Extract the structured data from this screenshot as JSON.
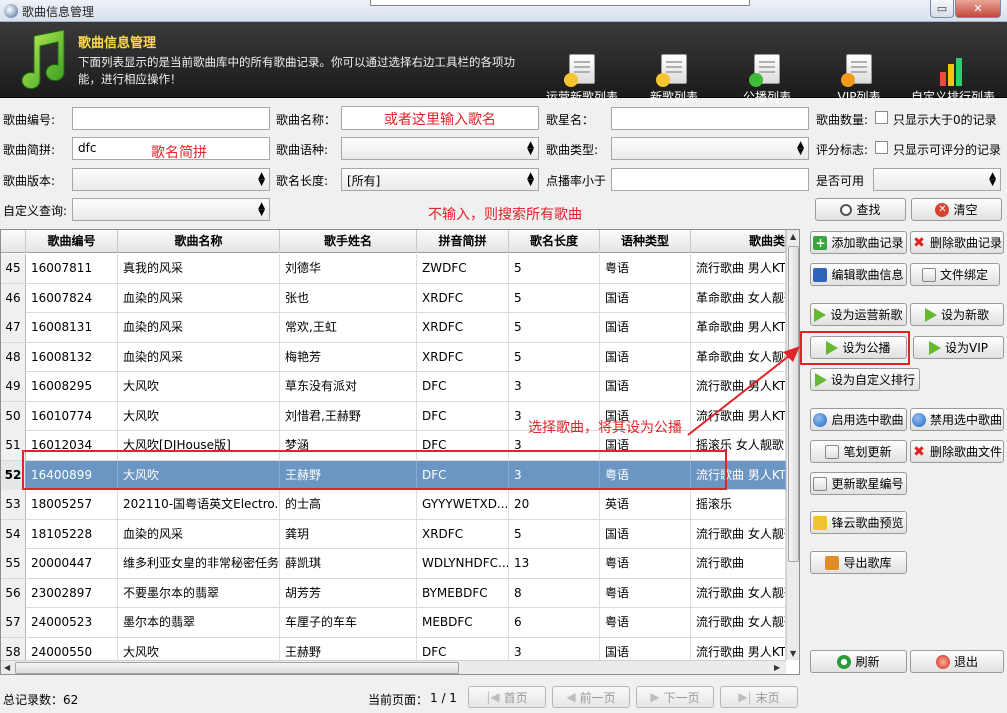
{
  "window": {
    "title": "歌曲信息管理",
    "close_label": "✕",
    "min_label": "▭"
  },
  "banner": {
    "title": "歌曲信息管理",
    "description": "下面列表显示的是当前歌曲库中的所有歌曲记录。你可以通过选择右边工具栏的各项功能，进行相应操作！",
    "tools": [
      "运营新歌列表",
      "新歌列表",
      "公播列表",
      "VIP列表",
      "自定义排行列表"
    ]
  },
  "form": {
    "song_no_label": "歌曲编号:",
    "song_name_label": "歌曲名称：",
    "song_name_placeholder": "或者这里输入歌名",
    "singer_label": "歌星名：",
    "song_count_label": "歌曲数量:",
    "only_gt0_label": "只显示大于0的记录",
    "pinyin_label": "歌曲简拼:",
    "pinyin_value": "dfc",
    "pinyin_annotation": "歌名简拼",
    "lang_label": "歌曲语种:",
    "type_label": "歌曲类型:",
    "rating_flag_label": "评分标志:",
    "only_rated_label": "只显示可评分的记录",
    "version_label": "歌曲版本:",
    "name_len_label": "歌名长度:",
    "name_len_value": "[所有]",
    "play_rate_label": "点播率小于",
    "usable_label": "是否可用",
    "custom_query_label": "自定义查询:",
    "hint_annotation": "不输入，则搜索所有歌曲",
    "search_btn": "查找",
    "clear_btn": "清空"
  },
  "table": {
    "headers": [
      "歌曲编号",
      "歌曲名称",
      "歌手姓名",
      "拼音简拼",
      "歌名长度",
      "语种类型",
      "歌曲类"
    ],
    "rows": [
      [
        "45",
        "16007811",
        "真我的风采",
        "刘德华",
        "ZWDFC",
        "5",
        "粤语",
        "流行歌曲 男人KTV"
      ],
      [
        "46",
        "16007824",
        "血染的风采",
        "张也",
        "XRDFC",
        "5",
        "国语",
        "革命歌曲 女人靓歌"
      ],
      [
        "47",
        "16008131",
        "血染的风采",
        "常欢,王虹",
        "XRDFC",
        "5",
        "国语",
        "革命歌曲 男人KTV"
      ],
      [
        "48",
        "16008132",
        "血染的风采",
        "梅艳芳",
        "XRDFC",
        "5",
        "国语",
        "革命歌曲 女人靓歌"
      ],
      [
        "49",
        "16008295",
        "大风吹",
        "草东没有派对",
        "DFC",
        "3",
        "国语",
        "流行歌曲 男人KTV"
      ],
      [
        "50",
        "16010774",
        "大风吹",
        "刘惜君,王赫野",
        "DFC",
        "3",
        "国语",
        "流行歌曲 男人KTV"
      ],
      [
        "51",
        "16012034",
        "大风吹[DJHouse版]",
        "梦涵",
        "DFC",
        "3",
        "国语",
        "摇滚乐 女人靓歌"
      ],
      [
        "52",
        "16400899",
        "大风吹",
        "王赫野",
        "DFC",
        "3",
        "粤语",
        "流行歌曲 男人KTV"
      ],
      [
        "53",
        "18005257",
        "202110-国粤语英文Electro...",
        "的士高",
        "GYYYWETXD...",
        "20",
        "英语",
        "摇滚乐"
      ],
      [
        "54",
        "18105228",
        "血染的风采",
        "龚玥",
        "XRDFC",
        "5",
        "国语",
        "流行歌曲 女人靓歌"
      ],
      [
        "55",
        "20000447",
        "维多利亚女皇的非常秘密任务",
        "薛凯琪",
        "WDLYNHDFC...",
        "13",
        "粤语",
        "流行歌曲"
      ],
      [
        "56",
        "23002897",
        "不要墨尔本的翡翠",
        "胡芳芳",
        "BYMEBDFC",
        "8",
        "粤语",
        "流行歌曲 女人靓歌"
      ],
      [
        "57",
        "24000523",
        "墨尔本的翡翠",
        "车厘子的车车",
        "MEBDFC",
        "6",
        "粤语",
        "流行歌曲 女人靓歌"
      ],
      [
        "58",
        "24000550",
        "大风吹",
        "王赫野",
        "DFC",
        "3",
        "国语",
        "流行歌曲 男人KTV"
      ]
    ],
    "selected_row": "52",
    "annotation": "选择歌曲，将其设为公播"
  },
  "side": {
    "add": "添加歌曲记录",
    "delete": "删除歌曲记录",
    "edit": "编辑歌曲信息",
    "bind": "文件绑定",
    "set_op_new": "设为运营新歌",
    "set_new": "设为新歌",
    "set_public": "设为公播",
    "set_vip": "设为VIP",
    "set_custom": "设为自定义排行",
    "enable": "启用选中歌曲",
    "disable": "禁用选中歌曲",
    "stroke_update": "笔划更新",
    "delete_file": "删除歌曲文件",
    "update_singer_no": "更新歌星编号",
    "preview": "锋云歌曲预览",
    "export": "导出歌库",
    "refresh": "刷新",
    "exit": "退出"
  },
  "footer": {
    "total": "总记录数：62",
    "current_page_label": "当前页面：",
    "current_page": "1 / 1",
    "first": "首页",
    "prev": "前一页",
    "next": "下一页",
    "last": "末页"
  },
  "colors": {
    "annotation_red": "#e0242a",
    "selected_row": "#6b95c2",
    "banner_bg": "#222222",
    "banner_title": "#ffd84a"
  }
}
